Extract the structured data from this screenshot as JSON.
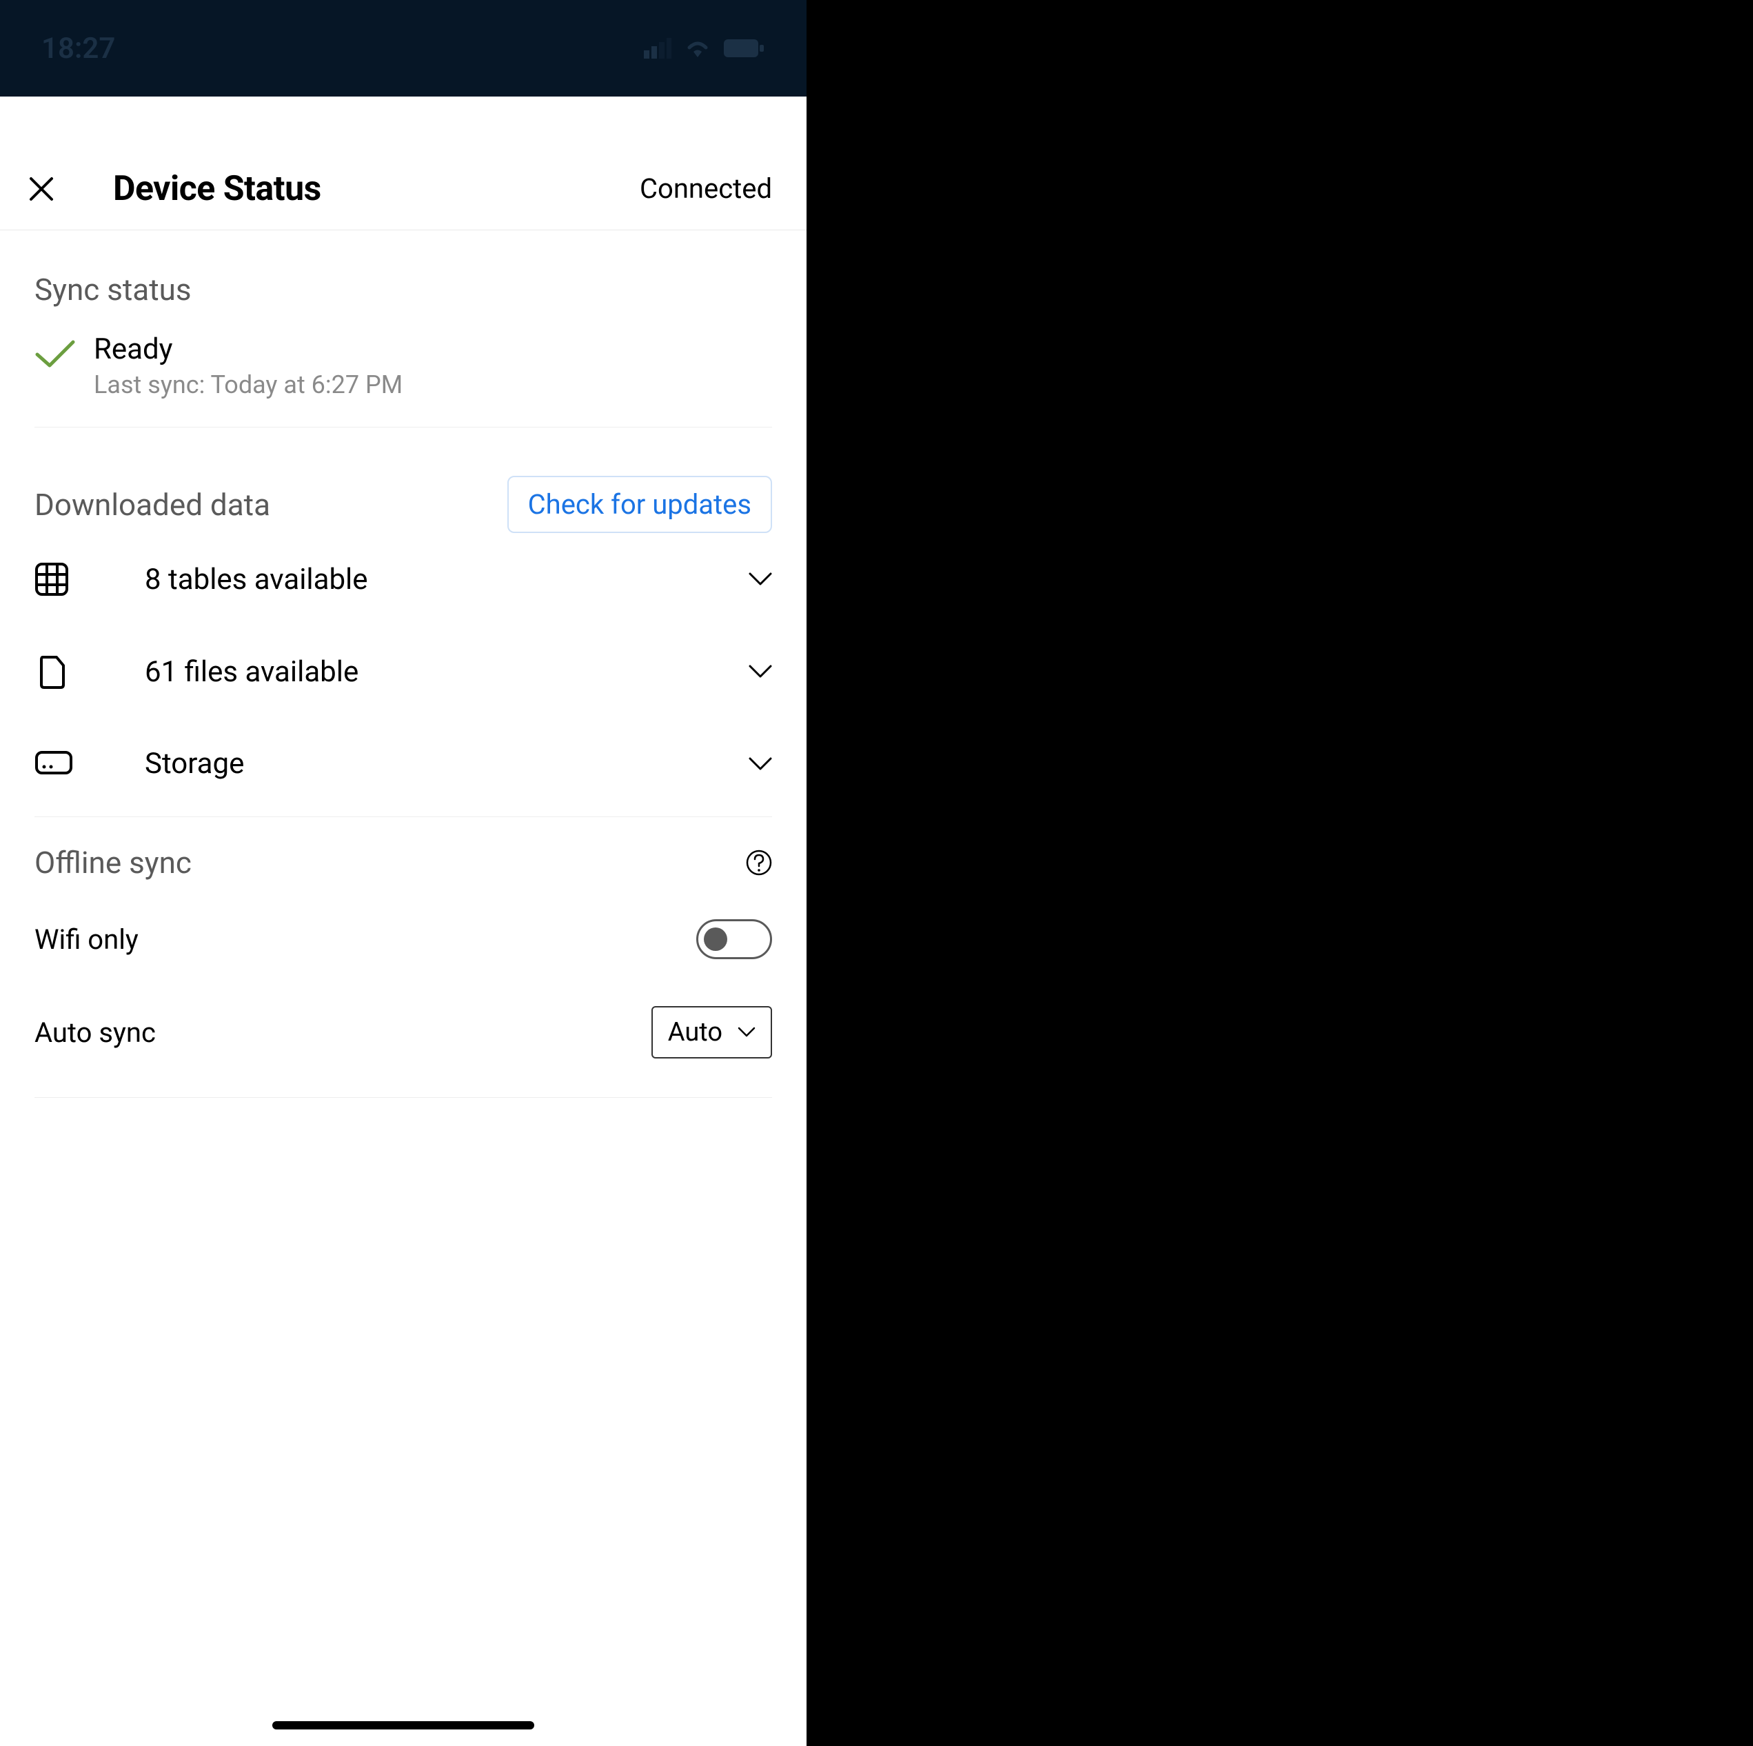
{
  "statusBar": {
    "time": "18:27"
  },
  "header": {
    "title": "Device Status",
    "status": "Connected"
  },
  "syncStatus": {
    "sectionLabel": "Sync status",
    "state": "Ready",
    "lastSync": "Last sync: Today at 6:27 PM"
  },
  "downloadedData": {
    "sectionLabel": "Downloaded data",
    "checkUpdatesLabel": "Check for updates",
    "rows": [
      {
        "label": "8 tables available"
      },
      {
        "label": "61 files available"
      },
      {
        "label": "Storage"
      }
    ]
  },
  "offlineSync": {
    "sectionLabel": "Offline sync",
    "wifiOnly": {
      "label": "Wifi only",
      "on": false
    },
    "autoSync": {
      "label": "Auto sync",
      "value": "Auto"
    }
  }
}
